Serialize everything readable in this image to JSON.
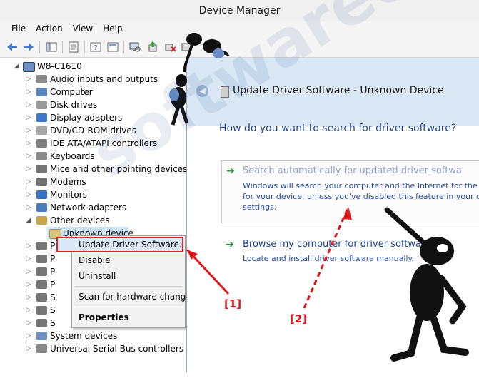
{
  "window": {
    "title": "Device Manager"
  },
  "menu": [
    "File",
    "Action",
    "View",
    "Help"
  ],
  "tree": {
    "root": "W8-C1610",
    "items": [
      "Audio inputs and outputs",
      "Computer",
      "Disk drives",
      "Display adapters",
      "DVD/CD-ROM drives",
      "IDE ATA/ATAPI controllers",
      "Keyboards",
      "Mice and other pointing devices",
      "Modems",
      "Monitors",
      "Network adapters",
      "Other devices"
    ],
    "child": "Unknown device",
    "hidden_prefixes": [
      "P",
      "P",
      "P",
      "P",
      "S",
      "S",
      "S"
    ],
    "tail": [
      "System devices",
      "Universal Serial Bus controllers"
    ]
  },
  "context_menu": {
    "items": [
      "Update Driver Software...",
      "Disable",
      "Uninstall",
      "Scan for hardware changes",
      "Properties"
    ]
  },
  "wizard": {
    "title": "Update Driver Software - Unknown Device",
    "question": "How do you want to search for driver software?",
    "option1": {
      "title": "Search automatically for updated driver softwa",
      "desc": [
        "Windows will search your computer and the Internet for the la",
        "for your device, unless you've disabled this feature in your de",
        "settings."
      ]
    },
    "option2": {
      "title": "Browse my computer for driver softwa",
      "desc": [
        "Locate and install driver software manually."
      ]
    }
  },
  "annotations": {
    "a1": "[1]",
    "a2": "[2]"
  },
  "watermark": "softwareok.com",
  "colors": {
    "accent_red": "#e0161a",
    "link_blue": "#1b3f8e",
    "wizard_head": "#dae8f5"
  }
}
